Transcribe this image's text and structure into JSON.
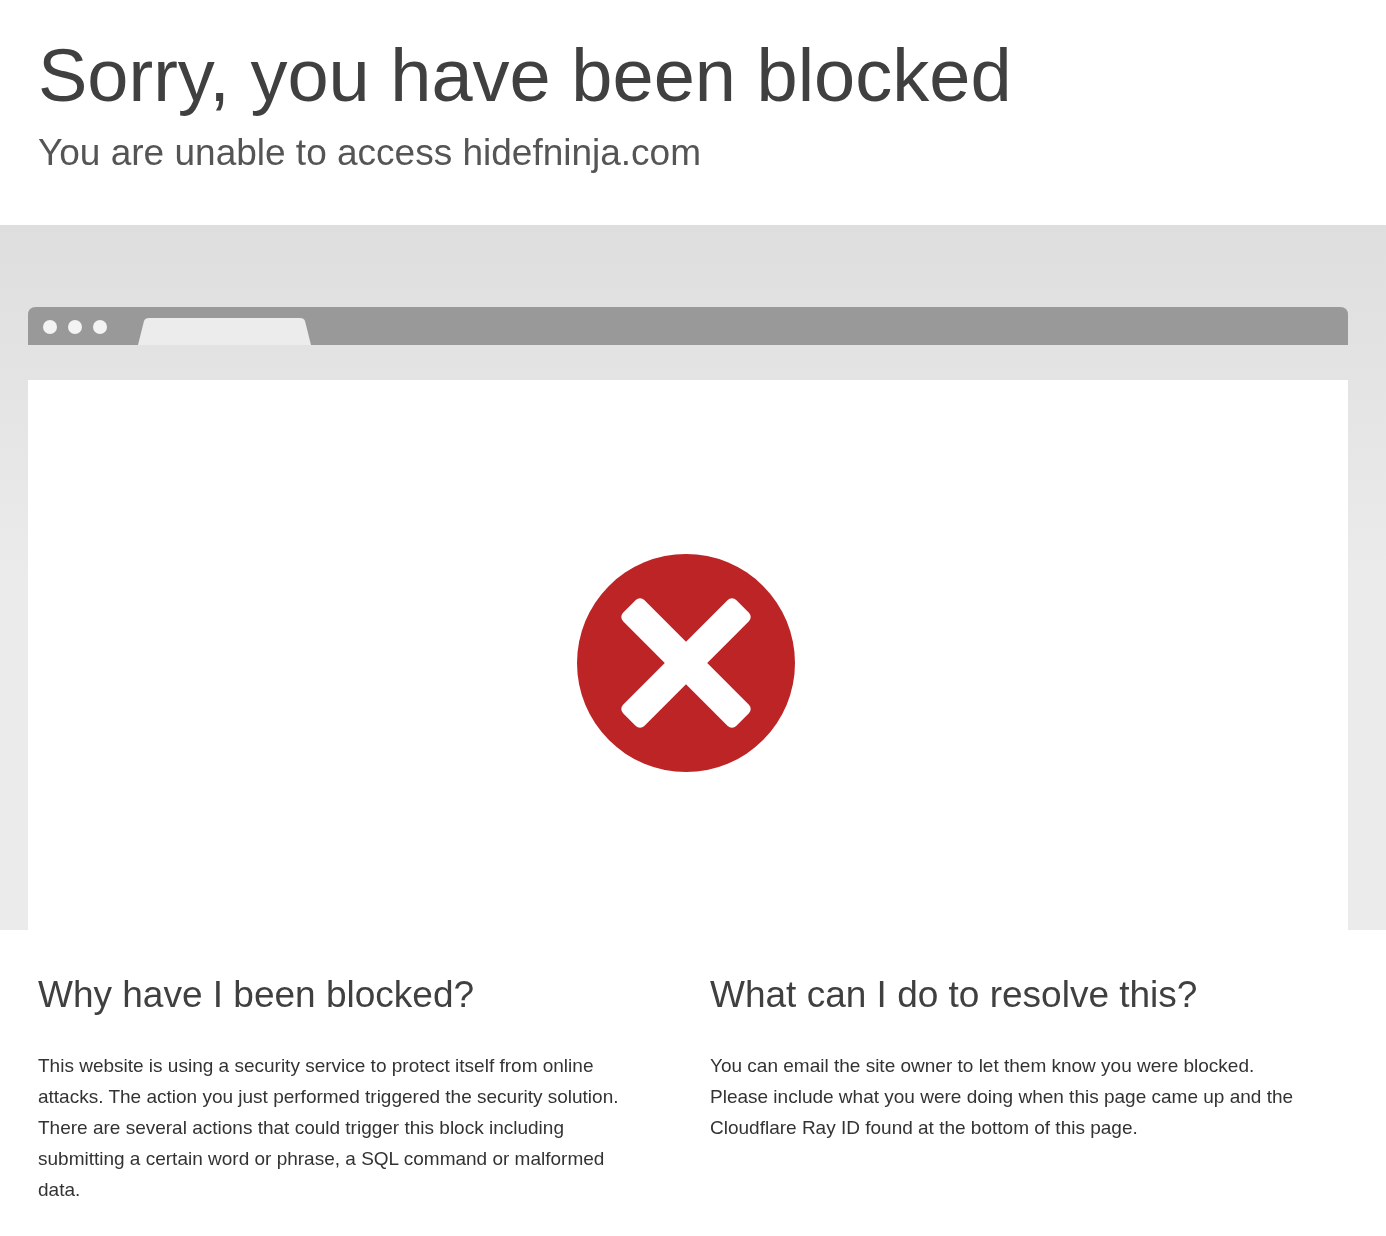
{
  "header": {
    "title": "Sorry, you have been blocked",
    "subtitle": "You are unable to access hidefninja.com"
  },
  "sections": [
    {
      "heading": "Why have I been blocked?",
      "text": "This website is using a security service to protect itself from online attacks. The action you just performed triggered the security solution. There are several actions that could trigger this block including submitting a certain word or phrase, a SQL command or malformed data."
    },
    {
      "heading": "What can I do to resolve this?",
      "text": "You can email the site owner to let them know you were blocked. Please include what you were doing when this page came up and the Cloudflare Ray ID found at the bottom of this page."
    }
  ]
}
